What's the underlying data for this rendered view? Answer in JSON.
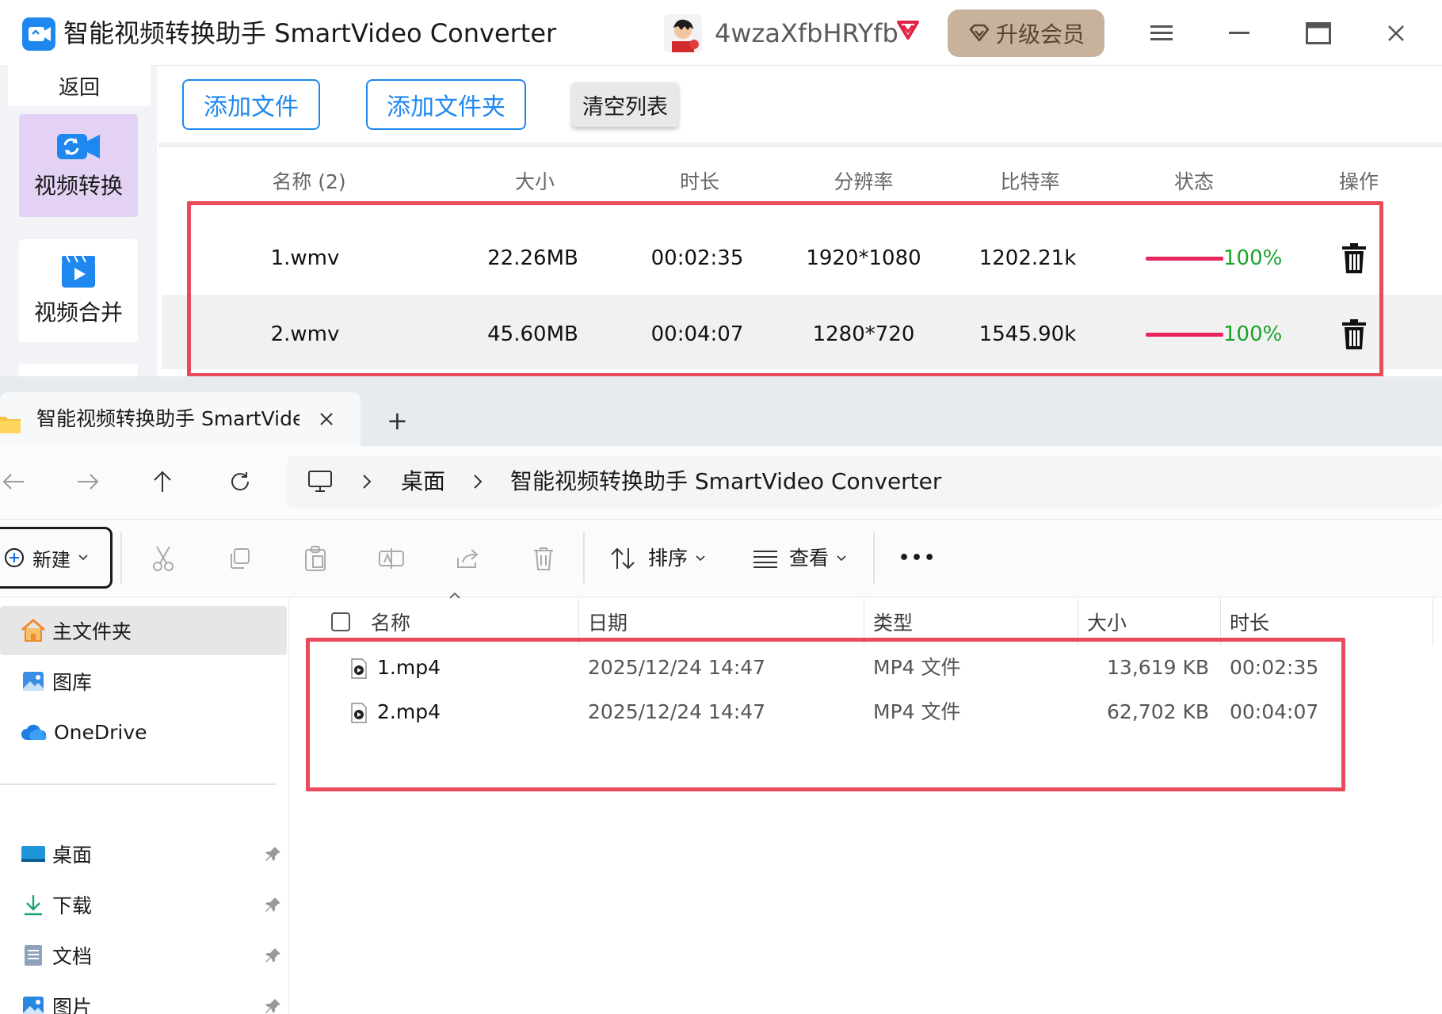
{
  "app": {
    "title": "智能视频转换助手 SmartVideo Converter",
    "username": "4wzaXfbHRYfb",
    "upgrade_label": "升级会员",
    "back_label": "返回",
    "sidebar_items": [
      {
        "label": "视频转换",
        "active": true
      },
      {
        "label": "视频合并",
        "active": false
      }
    ],
    "toolbar": {
      "add_file": "添加文件",
      "add_folder": "添加文件夹",
      "clear_list": "清空列表"
    },
    "table": {
      "headers": {
        "name": "名称 (2)",
        "size": "大小",
        "duration": "时长",
        "resolution": "分辨率",
        "bitrate": "比特率",
        "status": "状态",
        "action": "操作"
      },
      "rows": [
        {
          "name": "1.wmv",
          "size": "22.26MB",
          "duration": "00:02:35",
          "resolution": "1920*1080",
          "bitrate": "1202.21k",
          "progress": 1.0,
          "status": "100%"
        },
        {
          "name": "2.wmv",
          "size": "45.60MB",
          "duration": "00:04:07",
          "resolution": "1280*720",
          "bitrate": "1545.90k",
          "progress": 1.0,
          "status": "100%"
        }
      ]
    },
    "colors": {
      "accent": "#1e88f0",
      "progress": "#e8245c",
      "status_ok": "#1aa32a",
      "highlight": "#ea4a5a",
      "upgrade_bg": "#c9b29b"
    }
  },
  "explorer": {
    "tab_title": "智能视频转换助手 SmartVideo Converter",
    "new_tab_symbol": "+",
    "breadcrumb": [
      "桌面",
      "智能视频转换助手 SmartVideo Converter"
    ],
    "commands": {
      "new": "新建",
      "sort": "排序",
      "view": "查看",
      "more": "•••"
    },
    "nav": {
      "home": "主文件夹",
      "gallery": "图库",
      "onedrive": "OneDrive",
      "pinned": [
        "桌面",
        "下载",
        "文档",
        "图片"
      ]
    },
    "columns": {
      "name": "名称",
      "date": "日期",
      "type": "类型",
      "size": "大小",
      "duration": "时长"
    },
    "files": [
      {
        "name": "1.mp4",
        "date": "2025/12/24 14:47",
        "type": "MP4 文件",
        "size": "13,619 KB",
        "duration": "00:02:35"
      },
      {
        "name": "2.mp4",
        "date": "2025/12/24 14:47",
        "type": "MP4 文件",
        "size": "62,702 KB",
        "duration": "00:04:07"
      }
    ]
  }
}
